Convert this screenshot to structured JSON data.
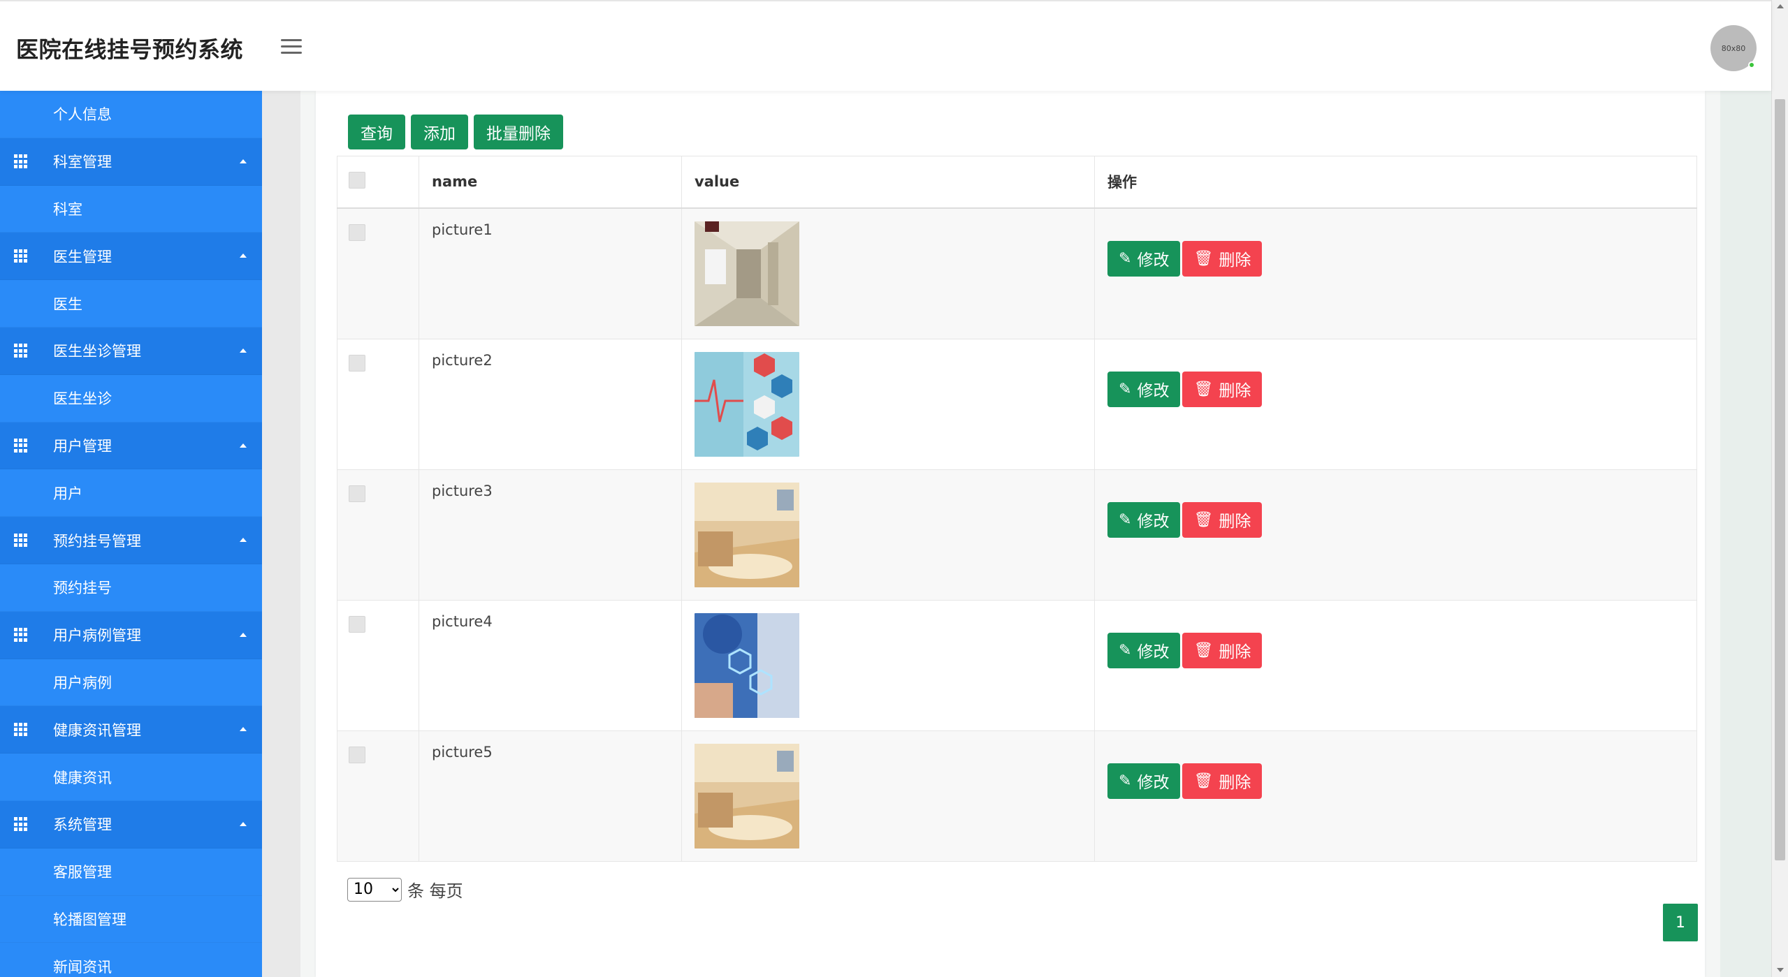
{
  "header": {
    "title": "医院在线挂号预约系统",
    "avatar_text": "80x80",
    "colors": {
      "status_online": "#3bc43b"
    }
  },
  "sidebar": {
    "items": [
      {
        "type": "sub",
        "label": "个人信息"
      },
      {
        "type": "group",
        "label": "科室管理",
        "icon": "grid-icon"
      },
      {
        "type": "sub",
        "label": "科室"
      },
      {
        "type": "group",
        "label": "医生管理",
        "icon": "grid-icon"
      },
      {
        "type": "sub",
        "label": "医生"
      },
      {
        "type": "group",
        "label": "医生坐诊管理",
        "icon": "grid-icon"
      },
      {
        "type": "sub",
        "label": "医生坐诊"
      },
      {
        "type": "group",
        "label": "用户管理",
        "icon": "grid-icon"
      },
      {
        "type": "sub",
        "label": "用户"
      },
      {
        "type": "group",
        "label": "预约挂号管理",
        "icon": "grid-icon"
      },
      {
        "type": "sub",
        "label": "预约挂号"
      },
      {
        "type": "group",
        "label": "用户病例管理",
        "icon": "grid-icon"
      },
      {
        "type": "sub",
        "label": "用户病例"
      },
      {
        "type": "group",
        "label": "健康资讯管理",
        "icon": "grid-icon"
      },
      {
        "type": "sub",
        "label": "健康资讯"
      },
      {
        "type": "group",
        "label": "系统管理",
        "icon": "grid-icon"
      },
      {
        "type": "sub",
        "label": "客服管理"
      },
      {
        "type": "sub",
        "label": "轮播图管理"
      },
      {
        "type": "sub",
        "label": "新闻资讯"
      }
    ],
    "colors": {
      "background": "#2485f5"
    }
  },
  "toolbar": {
    "query_label": "查询",
    "add_label": "添加",
    "batch_delete_label": "批量删除"
  },
  "table": {
    "headers": {
      "name": "name",
      "value": "value",
      "ops": "操作"
    },
    "rows": [
      {
        "name": "picture1",
        "image": "hospital-corridor-image"
      },
      {
        "name": "picture2",
        "image": "medical-hexagon-image"
      },
      {
        "name": "picture3",
        "image": "hospital-lobby-image"
      },
      {
        "name": "picture4",
        "image": "medical-tech-image"
      },
      {
        "name": "picture5",
        "image": "hospital-lobby-image"
      }
    ],
    "edit_label": "修改",
    "delete_label": "删除"
  },
  "pager": {
    "page_size": "10",
    "page_size_suffix": "条 每页",
    "current_page": "1"
  },
  "colors": {
    "primary": "#17935a",
    "danger": "#f4434f",
    "sidebar": "#2485f5"
  }
}
